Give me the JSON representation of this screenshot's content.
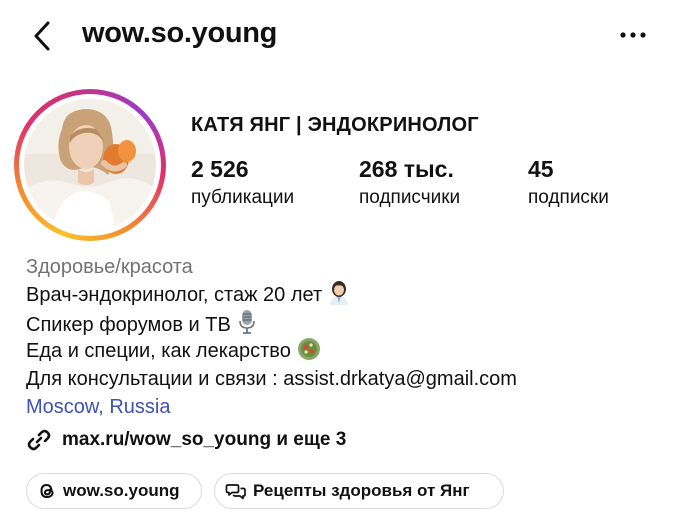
{
  "header": {
    "username": "wow.so.young",
    "back_icon": "chevron-left-icon",
    "more_icon": "more-horizontal-icon"
  },
  "profile": {
    "full_name": "КАТЯ ЯНГ | ЭНДОКРИНОЛОГ",
    "stats": [
      {
        "value": "2 526",
        "label": "публикации"
      },
      {
        "value": "268 тыс.",
        "label": "подписчики"
      },
      {
        "value": "45",
        "label": "подписки"
      }
    ],
    "story_ring_colors": [
      "#f9c02b",
      "#f58a2f",
      "#e1306c",
      "#c13584",
      "#9b3bc9"
    ]
  },
  "bio": {
    "category": "Здоровье/красота",
    "lines": [
      "Врач-эндокринолог, стаж 20 лет",
      "Спикер форумов и ТВ",
      "Еда и специи, как лекарство",
      "Для консультации и связи : assist.drkatya@gmail.com"
    ],
    "line_icons": [
      "doctor-emoji-icon",
      "microphone-emoji-icon",
      "salad-emoji-icon"
    ],
    "location": "Moscow, Russia",
    "location_color": "#3f51b5"
  },
  "links": {
    "text": "max.ru/wow_so_young и еще 3",
    "icon": "link-icon"
  },
  "chips": [
    {
      "label": "wow.so.young",
      "icon": "threads-icon"
    },
    {
      "label": "Рецепты здоровья от Янг",
      "icon": "chat-bubbles-icon"
    }
  ]
}
